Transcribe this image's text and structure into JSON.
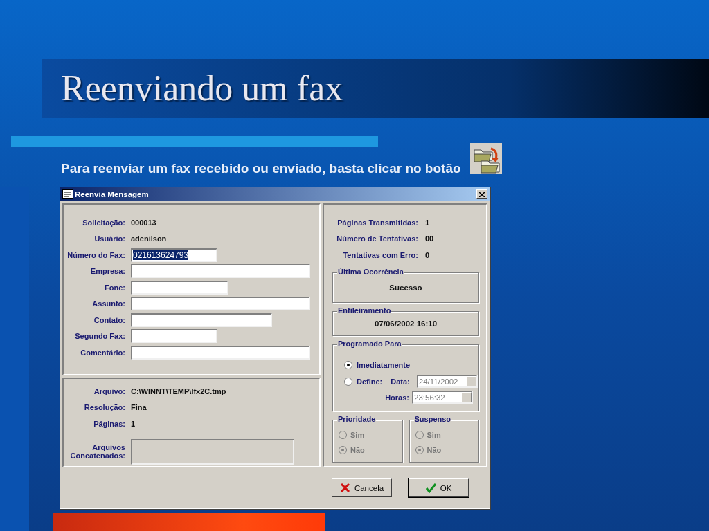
{
  "slide": {
    "title": "Reenviando um fax",
    "subtitle": "Para reenviar um fax recebido ou enviado, basta clicar no botão"
  },
  "window": {
    "title": "Reenvia Mensagem"
  },
  "message_fields": [
    {
      "kind": "text",
      "label": "Solicitação:",
      "value": "000013"
    },
    {
      "kind": "text",
      "label": "Usuário:",
      "value": "adenilson"
    },
    {
      "kind": "field",
      "label": "Número do Fax:",
      "value": "021613624793",
      "text_selected": true
    },
    {
      "kind": "field",
      "label": "Empresa:",
      "text_selected": false
    },
    {
      "kind": "field",
      "label": "Fone:",
      "text_selected": false
    },
    {
      "kind": "field",
      "label": "Assunto:",
      "text_selected": false
    },
    {
      "kind": "field",
      "label": "Contato:",
      "text_selected": false
    },
    {
      "kind": "field",
      "label": "Segundo Fax:",
      "text_selected": false
    },
    {
      "kind": "field",
      "label": "Comentário:",
      "text_selected": false
    }
  ],
  "file_fields": [
    {
      "kind": "text",
      "label": "Arquivo:",
      "value": "C:\\WINNT\\TEMP\\lfx2C.tmp"
    },
    {
      "kind": "text",
      "label": "Resolução:",
      "value": "Fina"
    },
    {
      "kind": "text",
      "label": "Páginas:",
      "value": "1"
    },
    {
      "kind": "list",
      "label": "Arquivos Concatenados:"
    }
  ],
  "stats": [
    {
      "label": "Páginas Transmitidas:",
      "value": "1"
    },
    {
      "label": "Número de Tentativas:",
      "value": "00"
    },
    {
      "label": "Tentativas com Erro:",
      "value": "0"
    }
  ],
  "last_event": {
    "title": "Última Ocorrência",
    "value": "Sucesso"
  },
  "queued": {
    "title": "Enfileiramento",
    "value": "07/06/2002 16:10"
  },
  "schedule": {
    "title": "Programado Para",
    "options": [
      {
        "label": "Imediatamente",
        "selected": true
      },
      {
        "label": "Define:",
        "selected": false
      }
    ],
    "date": {
      "label": "Data:",
      "value": "24/11/2002",
      "disabled": true
    },
    "time": {
      "label": "Horas:",
      "value": "23:56:32",
      "disabled": true
    }
  },
  "option_groups": [
    {
      "title": "Prioridade",
      "disabled": true,
      "options": [
        {
          "label": "Sim",
          "selected": false
        },
        {
          "label": "Não",
          "selected": true
        }
      ]
    },
    {
      "title": "Suspenso",
      "disabled": true,
      "options": [
        {
          "label": "Sim",
          "selected": false
        },
        {
          "label": "Não",
          "selected": true
        }
      ]
    }
  ],
  "buttons": [
    {
      "kind": "cancel",
      "label": "Cancela",
      "default": false
    },
    {
      "kind": "ok",
      "label": "OK",
      "default": true
    }
  ]
}
